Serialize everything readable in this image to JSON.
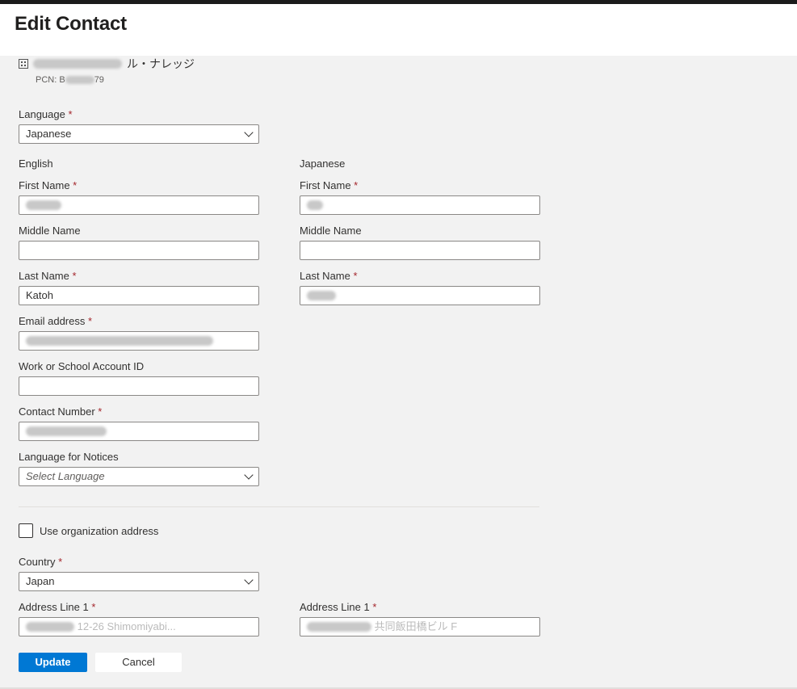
{
  "header": {
    "title": "Edit Contact"
  },
  "organization": {
    "name_suffix": "ル・ナレッジ",
    "pcn_prefix": "PCN: B",
    "pcn_suffix": "79"
  },
  "form": {
    "language": {
      "label": "Language",
      "value": "Japanese"
    },
    "english": {
      "heading": "English",
      "first_name": {
        "label": "First Name",
        "value": ""
      },
      "middle_name": {
        "label": "Middle Name",
        "value": ""
      },
      "last_name": {
        "label": "Last Name",
        "value": "Katoh"
      },
      "email": {
        "label": "Email address",
        "value": ""
      },
      "work_account": {
        "label": "Work or School Account ID",
        "value": ""
      },
      "contact_number": {
        "label": "Contact Number",
        "value": ""
      },
      "notice_language": {
        "label": "Language for Notices",
        "placeholder": "Select Language"
      }
    },
    "japanese": {
      "heading": "Japanese",
      "first_name": {
        "label": "First Name",
        "value": ""
      },
      "middle_name": {
        "label": "Middle Name",
        "value": ""
      },
      "last_name": {
        "label": "Last Name",
        "value": ""
      }
    },
    "use_org_address": {
      "label": "Use organization address",
      "checked": false
    },
    "country": {
      "label": "Country",
      "value": "Japan"
    },
    "address_line1_en": {
      "label": "Address Line 1",
      "value": "12-26 Shimomiyabi..."
    },
    "address_line1_ja": {
      "label": "Address Line 1",
      "value": "共同飯田橋ビル F"
    }
  },
  "footer": {
    "update_label": "Update",
    "cancel_label": "Cancel"
  },
  "colors": {
    "primary": "#0078d4",
    "required": "#a4262c",
    "panel": "#f2f2f2"
  }
}
